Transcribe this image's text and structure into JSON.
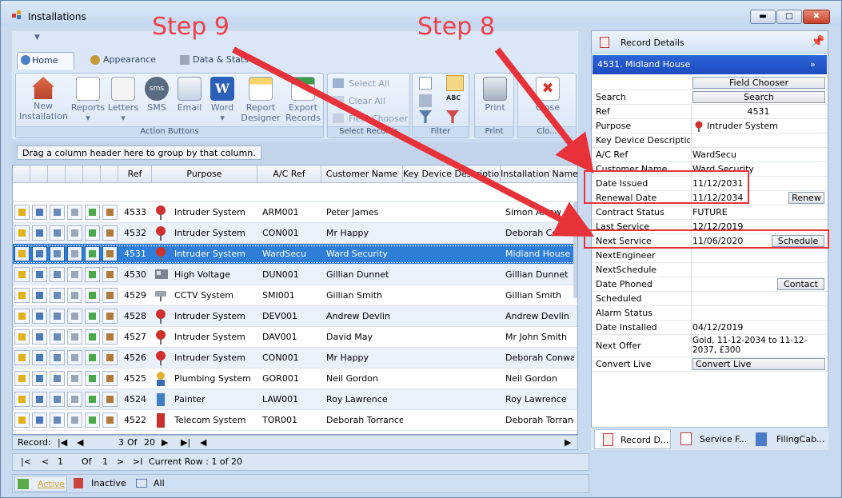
{
  "window": {
    "title": "Installations"
  },
  "ribbon": {
    "tabs": [
      {
        "label": "Home"
      },
      {
        "label": "Appearance"
      },
      {
        "label": "Data & Stats"
      }
    ],
    "groups": {
      "action": {
        "label": "Action Buttons",
        "buttons": [
          {
            "l1": "New",
            "l2": "Installation"
          },
          {
            "l1": "Reports",
            "l2": "▾"
          },
          {
            "l1": "Letters",
            "l2": "▾"
          },
          {
            "l1": "SMS",
            "l2": ""
          },
          {
            "l1": "Email",
            "l2": ""
          },
          {
            "l1": "Word",
            "l2": "▾"
          },
          {
            "l1": "Report",
            "l2": "Designer"
          },
          {
            "l1": "Export",
            "l2": "Records"
          }
        ]
      },
      "select": {
        "label": "Select Records",
        "select_all": "Select All",
        "clear_all": "Clear All",
        "field_chooser": "Field Chooser"
      },
      "filter": {
        "label": "Filter"
      },
      "print": {
        "label": "Print",
        "button": "Print"
      },
      "close": {
        "label": "Clo...",
        "button": "Close"
      }
    }
  },
  "grid": {
    "group_hint": "Drag a column header here to group by that column.",
    "columns": [
      "Ref",
      "Purpose",
      "A/C Ref",
      "Customer Name",
      "Key Device Description",
      "Installation Name"
    ],
    "rows": [
      {
        "ref": "4533",
        "purpose": "Intruder System",
        "ac": "ARM001",
        "cust": "Peter James",
        "key": "",
        "inst": "Simon Arrow",
        "icon": "intruder"
      },
      {
        "ref": "4532",
        "purpose": "Intruder System",
        "ac": "CON001",
        "cust": "Mr Happy",
        "key": "",
        "inst": "Deborah Conway",
        "icon": "intruder"
      },
      {
        "ref": "4531",
        "purpose": "Intruder System",
        "ac": "WardSecu",
        "cust": "Ward Security",
        "key": "",
        "inst": "Midland House",
        "icon": "intruder"
      },
      {
        "ref": "4530",
        "purpose": "High Voltage",
        "ac": "DUN001",
        "cust": "Gillian Dunnet",
        "key": "",
        "inst": "Gillian Dunnet",
        "icon": "voltage"
      },
      {
        "ref": "4529",
        "purpose": "CCTV System",
        "ac": "SMI001",
        "cust": "Gillian Smith",
        "key": "",
        "inst": "Gillian Smith",
        "icon": "cctv"
      },
      {
        "ref": "4528",
        "purpose": "Intruder System",
        "ac": "DEV001",
        "cust": "Andrew Devlin",
        "key": "",
        "inst": "Andrew Devlin",
        "icon": "intruder"
      },
      {
        "ref": "4527",
        "purpose": "Intruder System",
        "ac": "DAV001",
        "cust": "David May",
        "key": "",
        "inst": "Mr John Smith",
        "icon": "intruder"
      },
      {
        "ref": "4526",
        "purpose": "Intruder System",
        "ac": "CON001",
        "cust": "Mr Happy",
        "key": "",
        "inst": "Deborah Conway",
        "icon": "intruder"
      },
      {
        "ref": "4525",
        "purpose": "Plumbing System",
        "ac": "GOR001",
        "cust": "Neil Gordon",
        "key": "",
        "inst": "Neil Gordon",
        "icon": "plumbing"
      },
      {
        "ref": "4524",
        "purpose": "Painter",
        "ac": "LAW001",
        "cust": "Roy Lawrence",
        "key": "",
        "inst": "Roy Lawrence",
        "icon": "painter"
      },
      {
        "ref": "4522",
        "purpose": "Telecom System",
        "ac": "TOR001",
        "cust": "Deborah Torrance",
        "key": "",
        "inst": "Deborah Torrance",
        "icon": "telecom"
      }
    ],
    "selected_index": 2,
    "record_nav": {
      "label": "Record:",
      "current": "3",
      "of": "Of",
      "total": "20"
    }
  },
  "navbar": {
    "first": "|<",
    "prev": "<",
    "page": "1",
    "of": "Of",
    "total": "1",
    "next": ">",
    "last": ">I",
    "current_row": "Current Row : 1 of 20"
  },
  "statusbar": {
    "tabs": [
      {
        "label": "Active"
      },
      {
        "label": "Inactive"
      },
      {
        "label": "All"
      }
    ]
  },
  "details": {
    "title": "Record Details",
    "header": "4531. Midland House",
    "field_chooser": "Field Chooser",
    "search_label": "Search",
    "search_button": "Search",
    "rows": [
      {
        "label": "Ref",
        "value": "4531"
      },
      {
        "label": "Purpose",
        "value": "Intruder System"
      },
      {
        "label": "Key Device Description",
        "value": ""
      },
      {
        "label": "A/C Ref",
        "value": "WardSecu"
      },
      {
        "label": "Customer Name",
        "value": "Ward Security"
      },
      {
        "label": "Date Issued",
        "value": "11/12/2031"
      },
      {
        "label": "Renewal Date",
        "value": "11/12/2034",
        "button": "Renew"
      },
      {
        "label": "Contract Status",
        "value": "FUTURE"
      },
      {
        "label": "Last Service",
        "value": "12/12/2019"
      },
      {
        "label": "Next Service",
        "value": "11/06/2020",
        "button": "Schedule"
      },
      {
        "label": "NextEngineer",
        "value": ""
      },
      {
        "label": "NextSchedule",
        "value": ""
      },
      {
        "label": "Date Phoned",
        "value": "",
        "button": "Contact"
      },
      {
        "label": "Scheduled",
        "value": ""
      },
      {
        "label": "Alarm Status",
        "value": ""
      },
      {
        "label": "Date Installed",
        "value": "04/12/2019"
      },
      {
        "label": "Next Offer",
        "value": "Gold, 11-12-2034 to 11-12-2037, £300"
      },
      {
        "label": "Convert Live",
        "value": "",
        "button": "Convert Live"
      }
    ],
    "tabs": [
      {
        "label": "Record D..."
      },
      {
        "label": "Service F..."
      },
      {
        "label": "FilingCab..."
      }
    ]
  },
  "annotations": {
    "step9": "Step 9",
    "step8": "Step 8",
    "color": "#e8323a"
  }
}
